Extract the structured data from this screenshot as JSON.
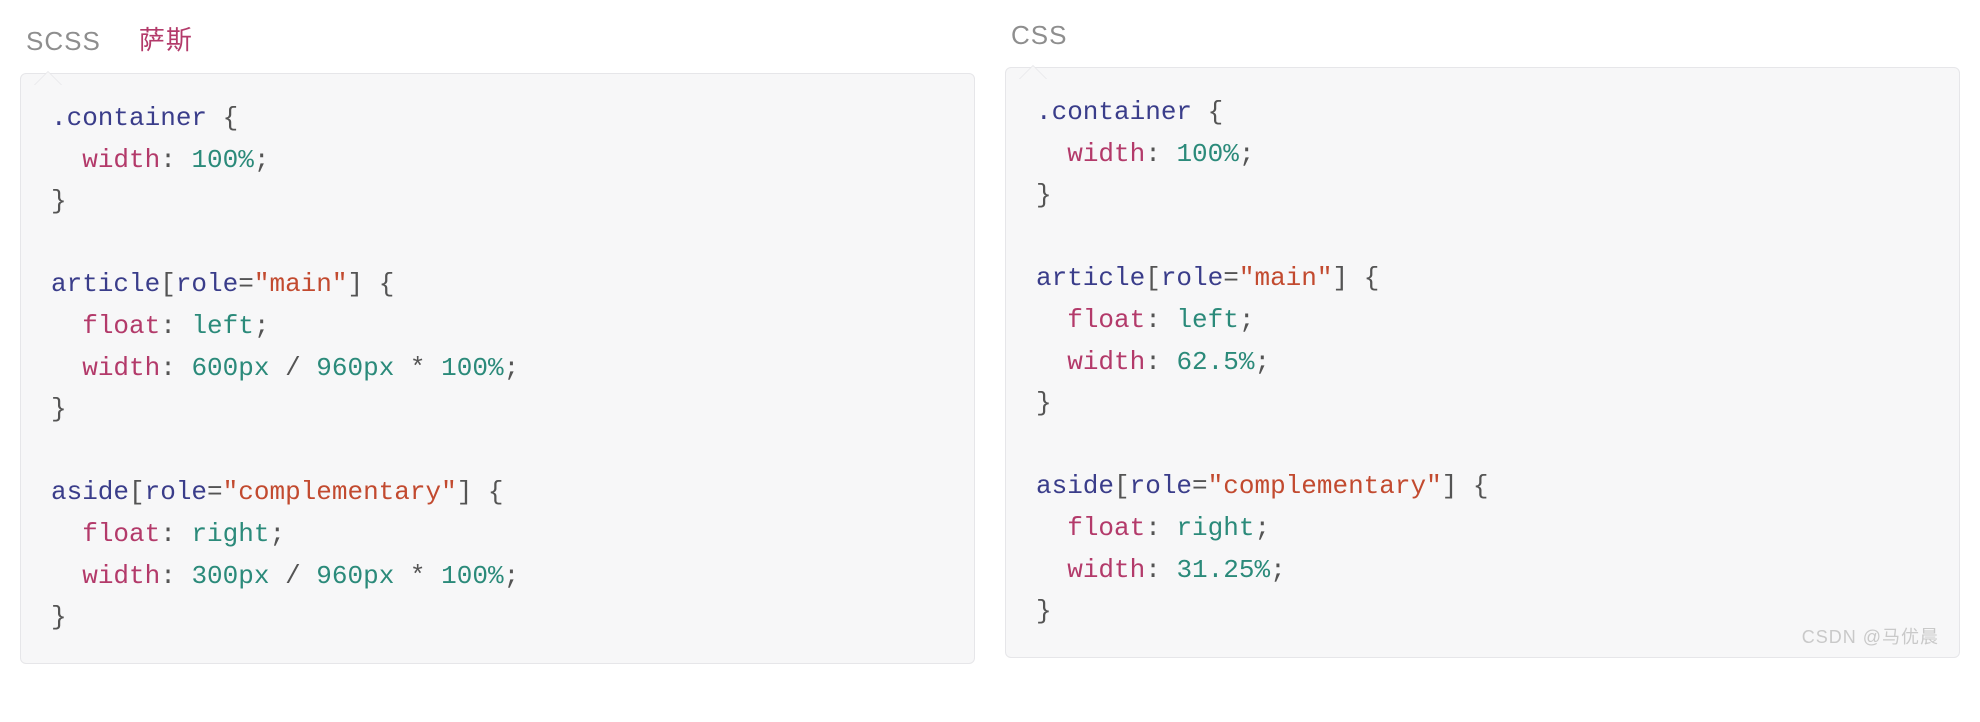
{
  "left": {
    "tabs": [
      {
        "label": "SCSS",
        "active": true,
        "alt": false
      },
      {
        "label": "萨斯",
        "active": false,
        "alt": true
      }
    ],
    "code": {
      "sel_container": ".container",
      "brace_open": "{",
      "brace_close": "}",
      "prop_width": "width",
      "colon": ":",
      "semicolon": ";",
      "val_100pct": "100%",
      "sel_article_tag": "article",
      "sel_article_attr_open": "[",
      "sel_article_attr_name": "role",
      "sel_article_attr_eq": "=",
      "sel_article_attr_val": "\"main\"",
      "sel_article_attr_close": "]",
      "prop_float": "float",
      "val_left": "left",
      "val_right": "right",
      "val_600px": "600px",
      "val_300px": "300px",
      "val_960px": "960px",
      "op_div": "/",
      "op_mul": "*",
      "sel_aside_tag": "aside",
      "sel_aside_attr_val": "\"complementary\""
    }
  },
  "right": {
    "tabs": [
      {
        "label": "CSS",
        "active": true,
        "alt": false
      }
    ],
    "code": {
      "sel_container": ".container",
      "brace_open": "{",
      "brace_close": "}",
      "prop_width": "width",
      "colon": ":",
      "semicolon": ";",
      "val_100pct": "100%",
      "sel_article_tag": "article",
      "sel_attr_open": "[",
      "sel_attr_name": "role",
      "sel_attr_eq": "=",
      "sel_attr_main": "\"main\"",
      "sel_attr_comp": "\"complementary\"",
      "sel_attr_close": "]",
      "prop_float": "float",
      "val_left": "left",
      "val_right": "right",
      "val_625": "62.5%",
      "val_3125": "31.25%",
      "sel_aside_tag": "aside"
    }
  },
  "watermark": "CSDN @马优晨"
}
